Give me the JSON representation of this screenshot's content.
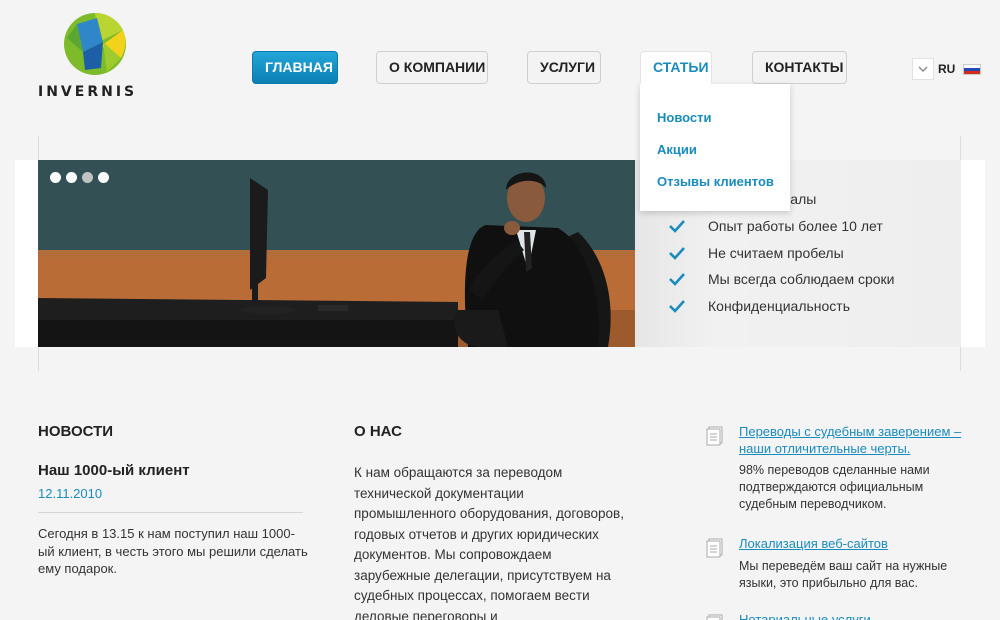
{
  "logo": {
    "text": "INVERNIS"
  },
  "nav": {
    "items": [
      {
        "label": "ГЛАВНАЯ"
      },
      {
        "label": "О КОМПАНИИ"
      },
      {
        "label": "УСЛУГИ"
      },
      {
        "label": "СТАТЬИ"
      },
      {
        "label": "КОНТАКТЫ"
      }
    ],
    "dropdown": [
      "Новости",
      "Акции",
      "Отзывы клиентов"
    ]
  },
  "lang": {
    "code": "RU"
  },
  "banner": {
    "slides_total": 4,
    "active_slide": 3,
    "features": [
      "Профессионалы",
      "Опыт работы более 10 лет",
      "Не считаем пробелы",
      "Мы всегда соблюдаем сроки",
      "Конфиденциальность"
    ]
  },
  "news": {
    "title": "НОВОСТИ",
    "headline": "Наш 1000-ый клиент",
    "date": "12.11.2010",
    "text": "Сегодня в 13.15 к нам поступил наш 1000-ый клиент, в честь этого мы решили сделать ему подарок."
  },
  "about": {
    "title": "О НАС",
    "text": "К нам обращаются за переводом технической документации промышленного оборудования, договоров, годовых отчетов и других юридических документов. Мы сопровождаем зарубежные делегации, присутствуем на судебных процессах, помогаем вести деловые переговоры и"
  },
  "articles": [
    {
      "title": "Переводы с судебным заверением – наши отличительные черты.",
      "text": "98% переводов сделанные нами подтверждаются официальным судебным переводчиком."
    },
    {
      "title": "Локализация веб-сайтов",
      "text": "Мы переведём ваш сайт на нужные языки, это прибыльно для вас."
    },
    {
      "title": "Нотариальные услуги",
      "text": ""
    }
  ],
  "colors": {
    "accent": "#1a8bbd",
    "nav_active": "#1493c9"
  }
}
